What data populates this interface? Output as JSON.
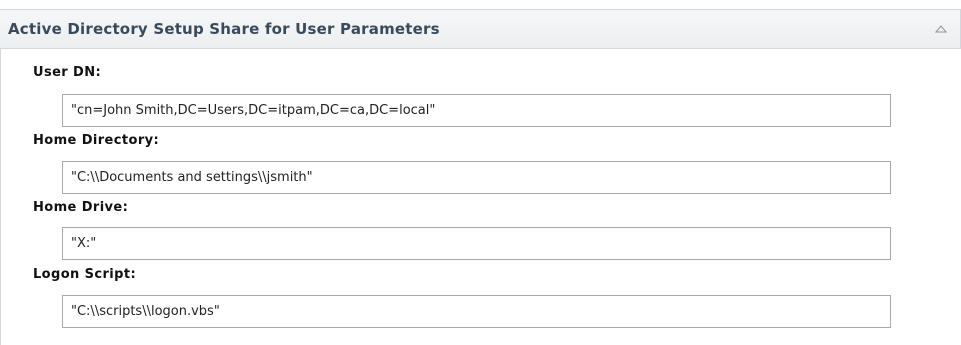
{
  "panel": {
    "title": "Active Directory Setup Share for User Parameters",
    "collapse_icon": "chevron-up-icon"
  },
  "fields": {
    "user_dn": {
      "label": "User DN:",
      "value": "\"cn=John Smith,DC=Users,DC=itpam,DC=ca,DC=local\""
    },
    "home_directory": {
      "label": "Home Directory:",
      "value": "\"C:\\\\Documents and settings\\\\jsmith\""
    },
    "home_drive": {
      "label": "Home Drive:",
      "value": "\"X:\""
    },
    "logon_script": {
      "label": "Logon Script:",
      "value": "\"C:\\\\scripts\\\\logon.vbs\""
    }
  },
  "colors": {
    "header_bg": "#eceef0",
    "border": "#d4d7db",
    "title_text": "#3a4a5c",
    "input_border": "#a9a9a9"
  }
}
